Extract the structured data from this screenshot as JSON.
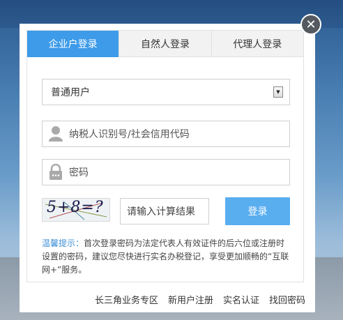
{
  "tabs": [
    {
      "label": "企业户登录",
      "active": true
    },
    {
      "label": "自然人登录",
      "active": false
    },
    {
      "label": "代理人登录",
      "active": false
    }
  ],
  "user_type_select": {
    "value": "普通用户"
  },
  "taxpayer_id_input": {
    "placeholder": "纳税人识别号/社会信用代码"
  },
  "password_input": {
    "placeholder": "密码"
  },
  "captcha": {
    "text": "5+8=?"
  },
  "captcha_input": {
    "placeholder": "请输入计算结果"
  },
  "login_button": {
    "label": "登录"
  },
  "tip": {
    "label": "温馨提示：",
    "text": "首次登录密码为法定代表人有效证件的后六位或注册时设置的密码，建议您尽快进行实名办税登记，享受更加顺畅的“互联网+”服务。"
  },
  "footer_links": [
    "长三角业务专区",
    "新用户注册",
    "实名认证",
    "找回密码"
  ],
  "close_icon": "close-icon",
  "colors": {
    "accent": "#3d9be9",
    "button": "#59aef0",
    "tip_label": "#3d8fd6"
  }
}
